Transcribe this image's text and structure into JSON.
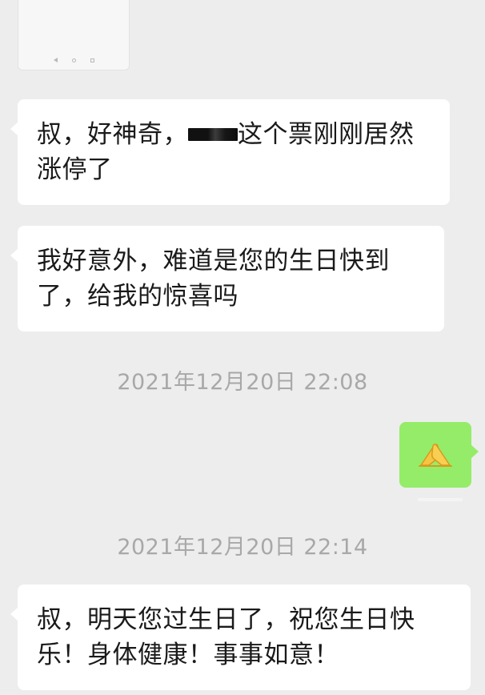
{
  "chat": {
    "messages": [
      {
        "side": "incoming",
        "type": "image",
        "icon": "phone-screenshot-thumbnail"
      },
      {
        "side": "incoming",
        "type": "text",
        "line1_prefix": "叔，好神奇，",
        "line1_suffix": "这个票刚刚居然",
        "line2": "涨停了"
      },
      {
        "side": "incoming",
        "type": "text",
        "line1": "我好意外，难道是您的生日快到",
        "line2": "了，给我的惊喜吗"
      },
      {
        "side": "outgoing",
        "type": "emoji",
        "icon": "folded-hands-icon"
      },
      {
        "side": "incoming",
        "type": "text",
        "line1": "叔，明天您过生日了，祝您生日快",
        "line2": "乐！身体健康！事事如意！"
      }
    ],
    "timestamps": [
      "2021年12月20日 22:08",
      "2021年12月20日 22:14"
    ]
  },
  "colors": {
    "background": "#ededed",
    "incoming_bubble": "#ffffff",
    "outgoing_bubble": "#95ec69",
    "timestamp_text": "#a8a8a8",
    "message_text": "#1a1a1a"
  }
}
